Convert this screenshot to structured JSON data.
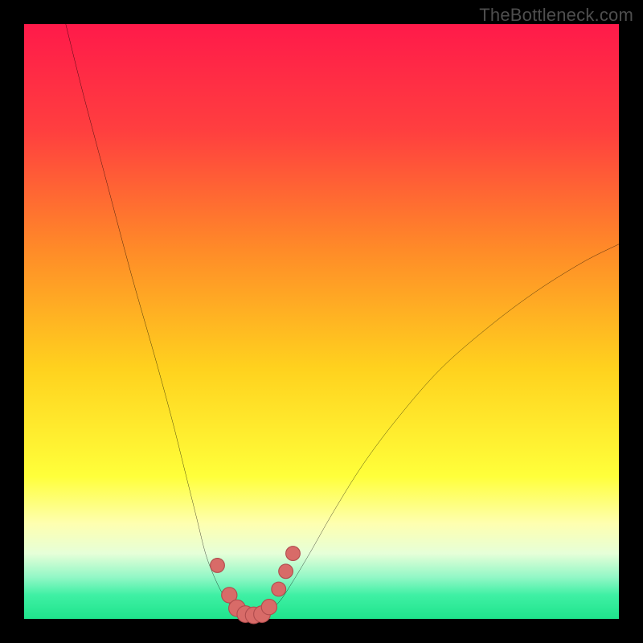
{
  "watermark": "TheBottleneck.com",
  "colors": {
    "frame": "#000000",
    "gradient_stops": [
      {
        "pct": 0,
        "color": "#ff1a4a"
      },
      {
        "pct": 18,
        "color": "#ff3f3f"
      },
      {
        "pct": 38,
        "color": "#ff8b28"
      },
      {
        "pct": 58,
        "color": "#ffd21e"
      },
      {
        "pct": 76,
        "color": "#ffff3a"
      },
      {
        "pct": 84,
        "color": "#feffb0"
      },
      {
        "pct": 89,
        "color": "#e6ffd8"
      },
      {
        "pct": 93,
        "color": "#92f7c6"
      },
      {
        "pct": 96,
        "color": "#3ff0a4"
      },
      {
        "pct": 100,
        "color": "#1fe48c"
      }
    ],
    "curve": "#000000",
    "marker_fill": "#d86b68",
    "marker_stroke": "#b04c4d"
  },
  "chart_data": {
    "type": "line",
    "title": "",
    "xlabel": "",
    "ylabel": "",
    "xlim": [
      0,
      100
    ],
    "ylim": [
      0,
      100
    ],
    "series": [
      {
        "name": "left-curve",
        "x": [
          7,
          10,
          14,
          18,
          22,
          25,
          27,
          29,
          30.5,
          32,
          33.5,
          35,
          36.5
        ],
        "y": [
          100,
          88,
          73,
          58,
          44,
          33,
          25,
          17,
          11,
          7,
          4,
          2,
          1
        ]
      },
      {
        "name": "right-curve",
        "x": [
          41,
          43,
          45,
          48,
          52,
          57,
          63,
          70,
          78,
          86,
          94,
          100
        ],
        "y": [
          1,
          3,
          6,
          11,
          18,
          26,
          34,
          42,
          49,
          55,
          60,
          63
        ]
      },
      {
        "name": "valley-floor",
        "x": [
          36.5,
          37.5,
          38.5,
          39.5,
          40.5,
          41
        ],
        "y": [
          1,
          0.5,
          0.4,
          0.4,
          0.6,
          1
        ]
      }
    ],
    "markers": [
      {
        "x": 32.5,
        "y": 9,
        "r": 1.2
      },
      {
        "x": 34.5,
        "y": 4,
        "r": 1.3
      },
      {
        "x": 35.8,
        "y": 1.8,
        "r": 1.4
      },
      {
        "x": 37.2,
        "y": 0.8,
        "r": 1.4
      },
      {
        "x": 38.6,
        "y": 0.6,
        "r": 1.4
      },
      {
        "x": 40.0,
        "y": 0.8,
        "r": 1.4
      },
      {
        "x": 41.2,
        "y": 2.0,
        "r": 1.3
      },
      {
        "x": 42.8,
        "y": 5.0,
        "r": 1.2
      },
      {
        "x": 44.0,
        "y": 8.0,
        "r": 1.2
      },
      {
        "x": 45.2,
        "y": 11.0,
        "r": 1.2
      }
    ]
  }
}
